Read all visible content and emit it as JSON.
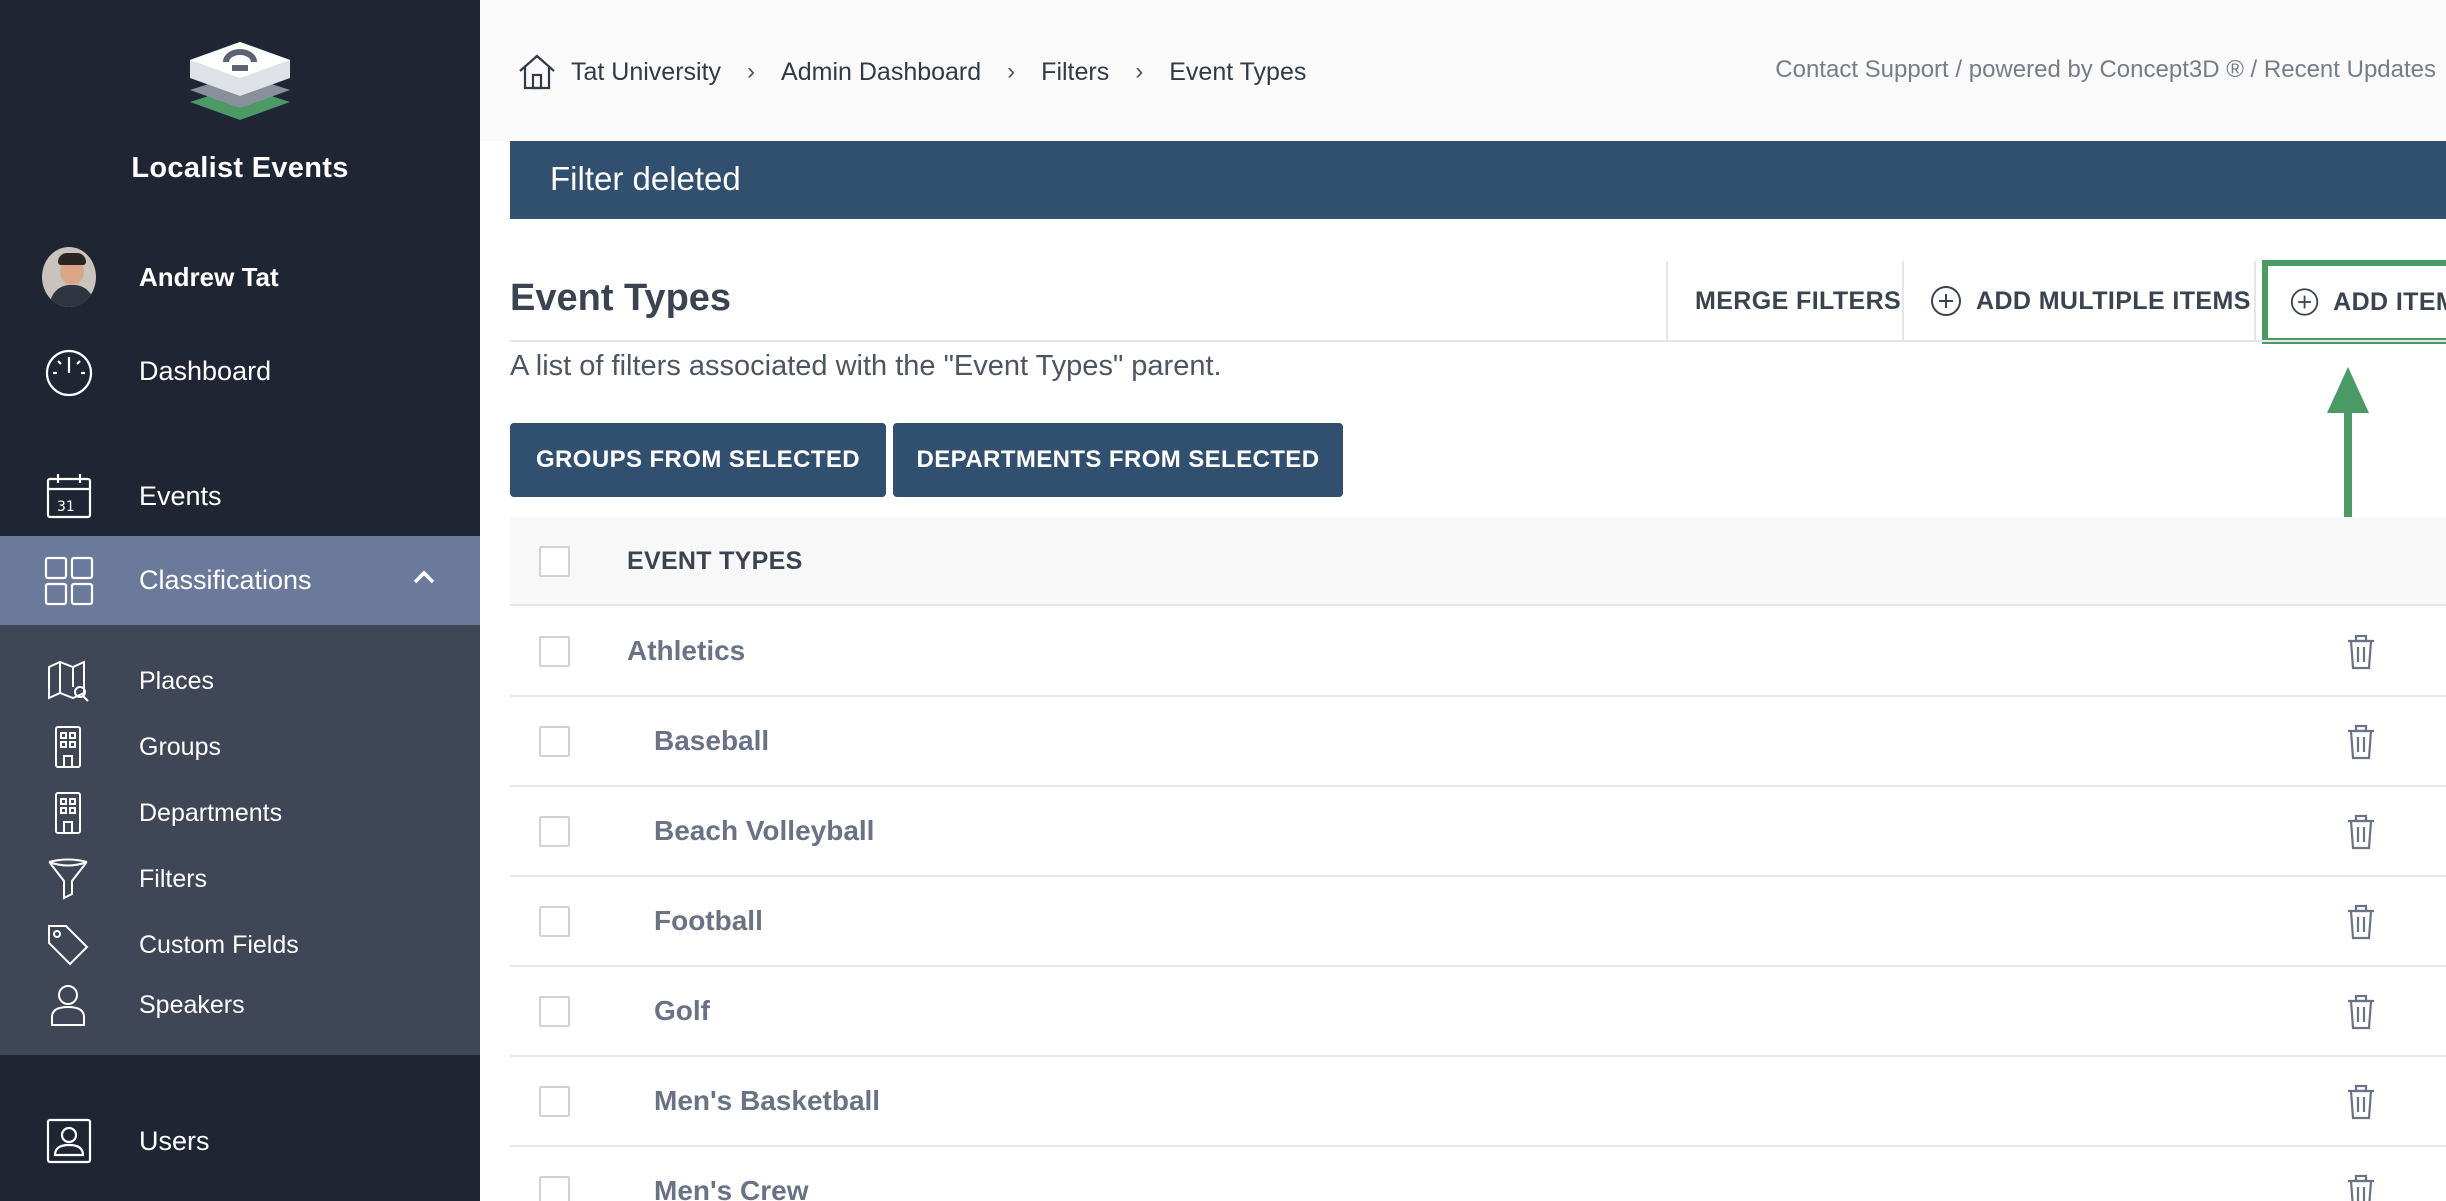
{
  "app": {
    "title": "Localist Events"
  },
  "user": {
    "name": "Andrew Tat"
  },
  "sidebar": {
    "dashboard": "Dashboard",
    "events": "Events",
    "classifications": "Classifications",
    "sub_items": [
      {
        "label": "Places",
        "icon": "map-icon"
      },
      {
        "label": "Groups",
        "icon": "building-icon"
      },
      {
        "label": "Departments",
        "icon": "building-icon"
      },
      {
        "label": "Filters",
        "icon": "funnel-icon"
      },
      {
        "label": "Custom Fields",
        "icon": "tag-icon"
      },
      {
        "label": "Speakers",
        "icon": "person-icon"
      }
    ],
    "users": "Users"
  },
  "breadcrumb": {
    "items": [
      "Tat University",
      "Admin Dashboard",
      "Filters",
      "Event Types"
    ],
    "separator": "›"
  },
  "top_links": "Contact Support / powered by Concept3D ® / Recent Updates",
  "banner": {
    "message": "Filter deleted"
  },
  "page": {
    "title": "Event Types",
    "subtitle": "A list of filters associated with the \"Event Types\" parent."
  },
  "actions": {
    "merge": "MERGE FILTERS",
    "add_multiple": "ADD MULTIPLE ITEMS",
    "add_item": "ADD ITEM",
    "groups_from_selected": "GROUPS FROM SELECTED",
    "departments_from_selected": "DEPARTMENTS FROM SELECTED"
  },
  "table": {
    "header": "EVENT TYPES",
    "rows": [
      {
        "name": "Athletics",
        "level": "parent"
      },
      {
        "name": "Baseball",
        "level": "child"
      },
      {
        "name": "Beach Volleyball",
        "level": "child"
      },
      {
        "name": "Football",
        "level": "child"
      },
      {
        "name": "Golf",
        "level": "child"
      },
      {
        "name": "Men's Basketball",
        "level": "child"
      },
      {
        "name": "Men's Crew",
        "level": "child"
      }
    ]
  },
  "colors": {
    "sidebar_bg": "#1f2533",
    "sidebar_active": "#6b7a9a",
    "submenu_bg": "#3f4656",
    "brand_blue": "#31506f",
    "highlight_green": "#4a9a66"
  }
}
